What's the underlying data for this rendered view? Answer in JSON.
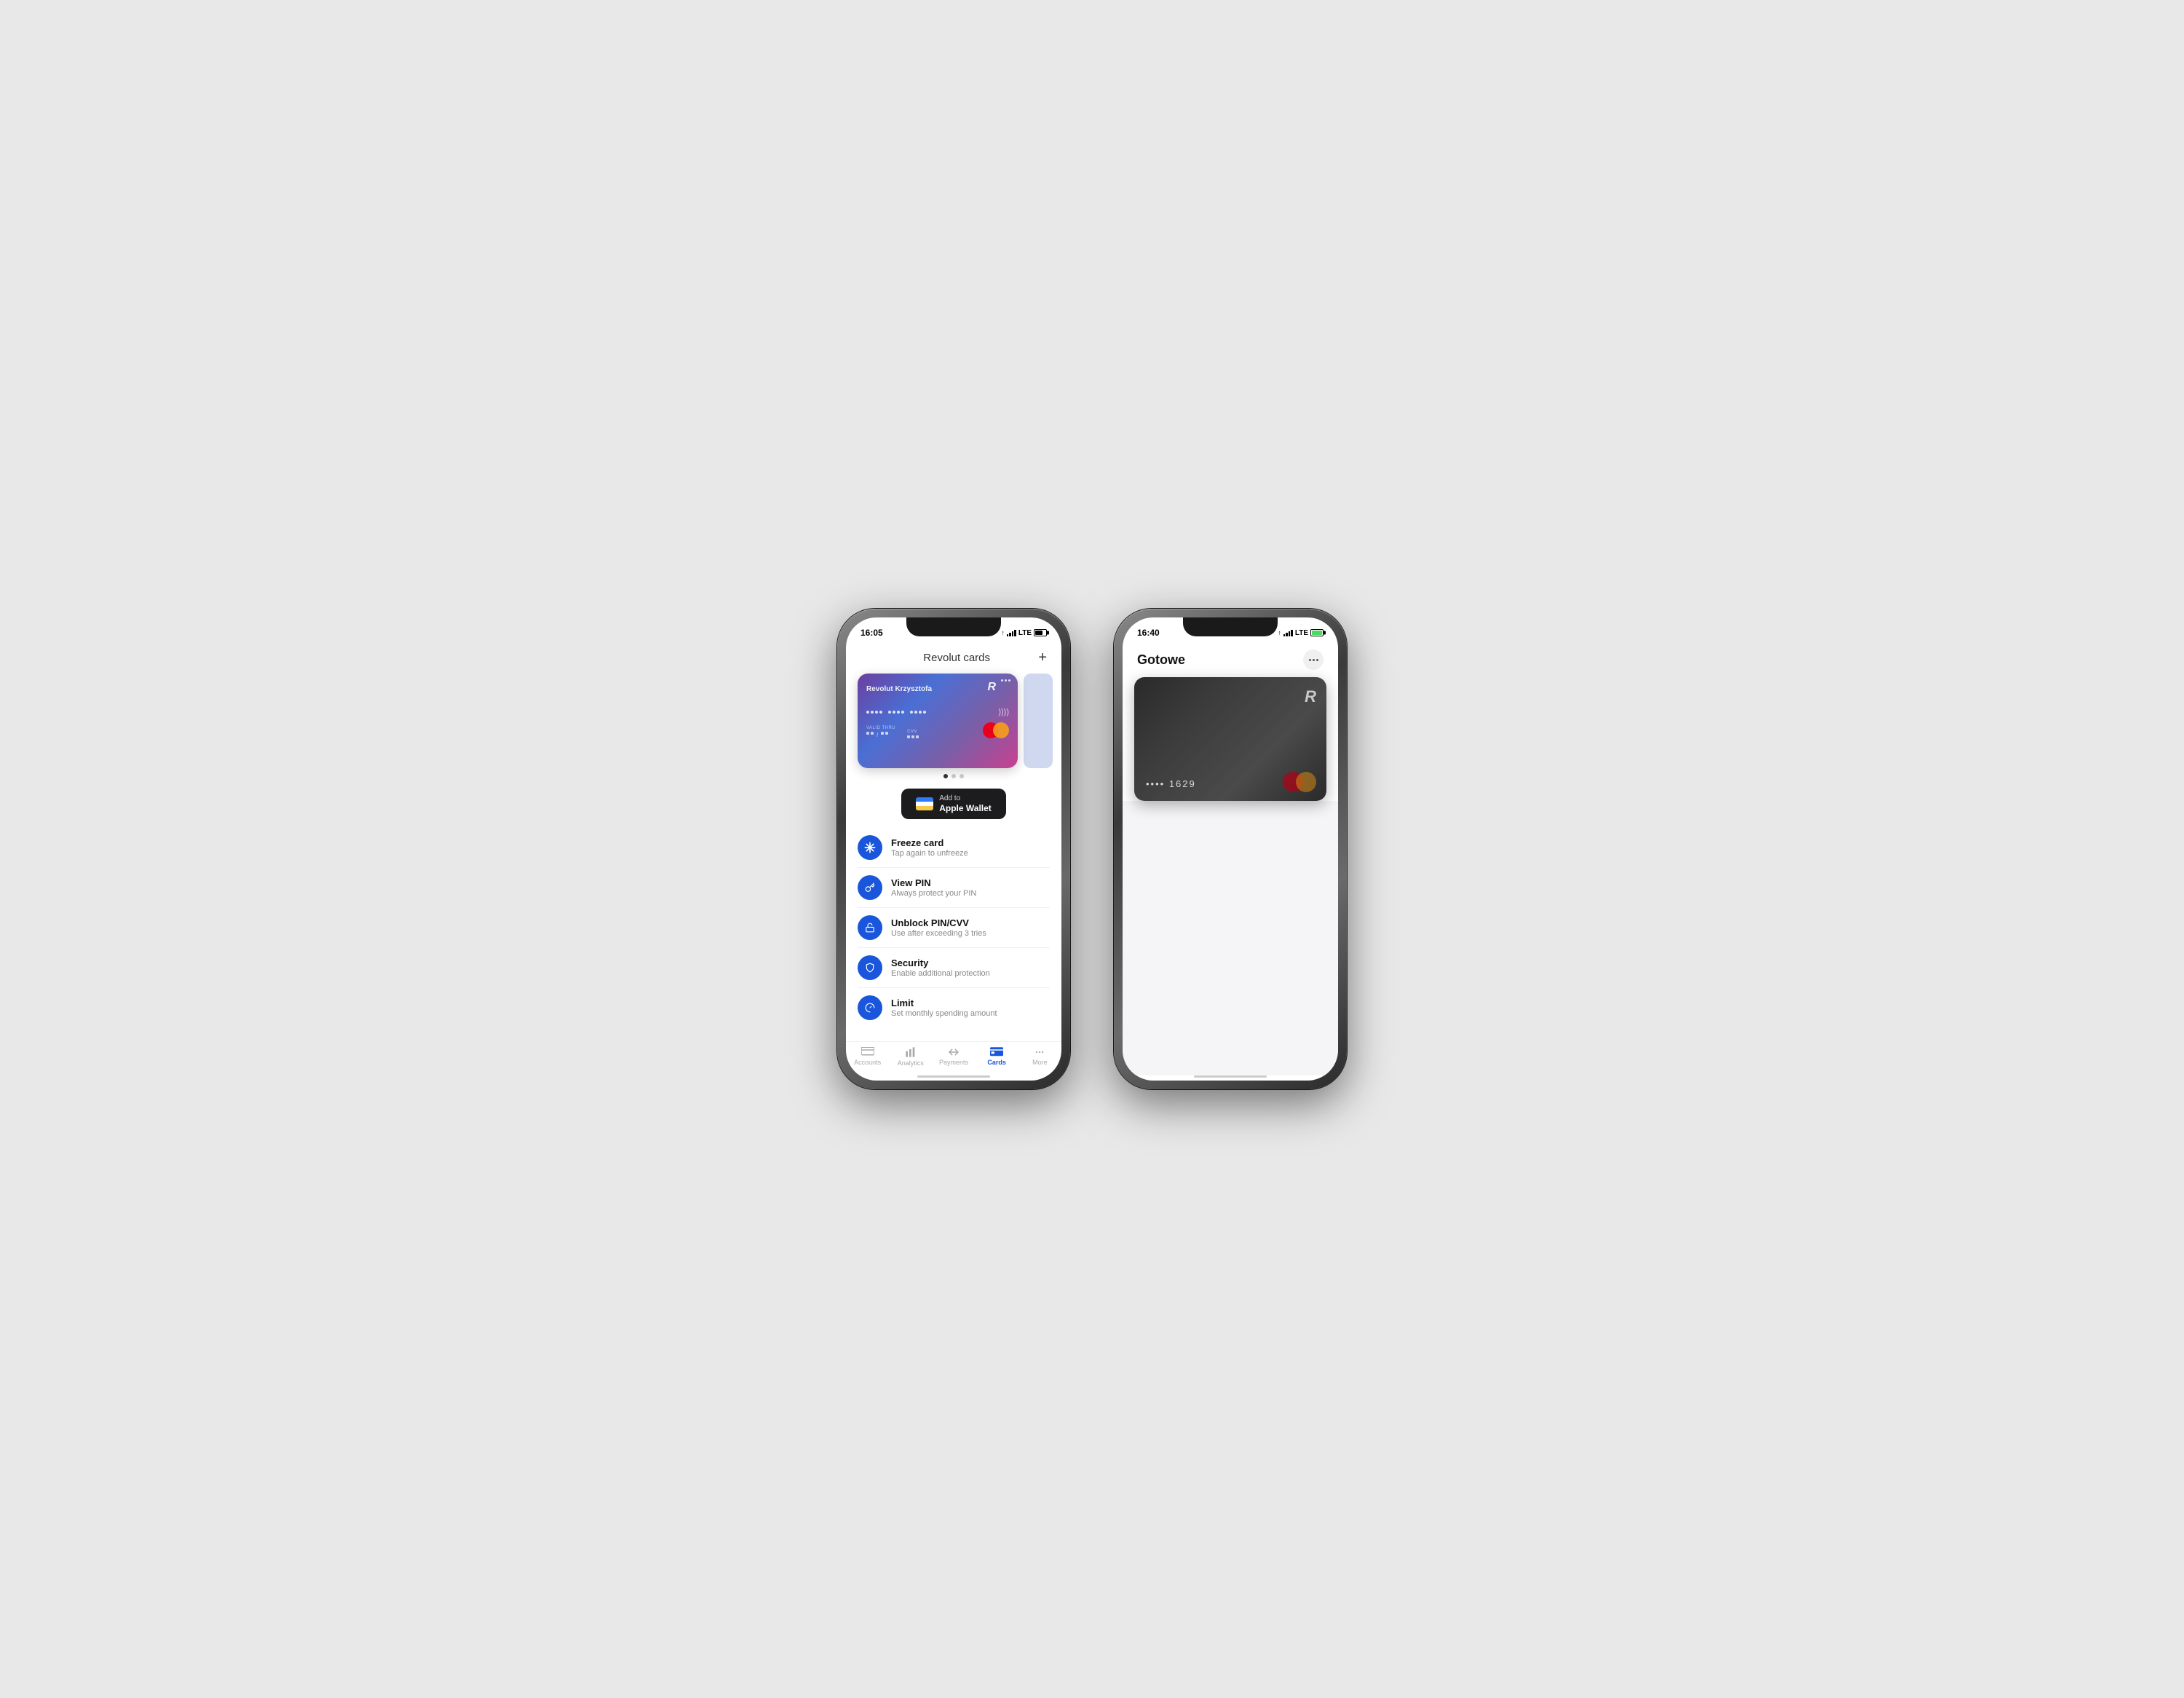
{
  "phone1": {
    "statusBar": {
      "time": "16:05",
      "arrow": "↑",
      "lte": "LTE"
    },
    "header": {
      "title": "Revolut cards",
      "addButton": "+"
    },
    "card": {
      "name": "Revolut Krzysztofa",
      "rLogo": "R",
      "validThruLabel": "VALID THRU",
      "cvvLabel": "CVV"
    },
    "indicators": [
      {
        "active": true
      },
      {
        "active": false
      },
      {
        "active": false
      }
    ],
    "appleWallet": {
      "addLine": "Add to",
      "mainLine": "Apple Wallet"
    },
    "menuItems": [
      {
        "icon": "❄",
        "title": "Freeze card",
        "subtitle": "Tap again to unfreeze"
      },
      {
        "icon": "🔑",
        "title": "View PIN",
        "subtitle": "Always protect your PIN"
      },
      {
        "icon": "🔓",
        "title": "Unblock PIN/CVV",
        "subtitle": "Use after exceeding 3 tries"
      },
      {
        "icon": "🛡",
        "title": "Security",
        "subtitle": "Enable additional protection"
      },
      {
        "icon": "⚡",
        "title": "Limit",
        "subtitle": "Set monthly spending amount"
      }
    ],
    "bottomNav": [
      {
        "label": "Accounts",
        "active": false,
        "icon": "⊟"
      },
      {
        "label": "Analytics",
        "active": false,
        "icon": "📊"
      },
      {
        "label": "Payments",
        "active": false,
        "icon": "↔"
      },
      {
        "label": "Cards",
        "active": true,
        "icon": "▬"
      },
      {
        "label": "More",
        "active": false,
        "icon": "⋯"
      }
    ]
  },
  "phone2": {
    "statusBar": {
      "time": "16:40",
      "arrow": "↑",
      "lte": "LTE"
    },
    "header": {
      "title": "Gotowe"
    },
    "card": {
      "rLogo": "R",
      "number": "•••• 1629",
      "brand": "mastercard"
    }
  }
}
